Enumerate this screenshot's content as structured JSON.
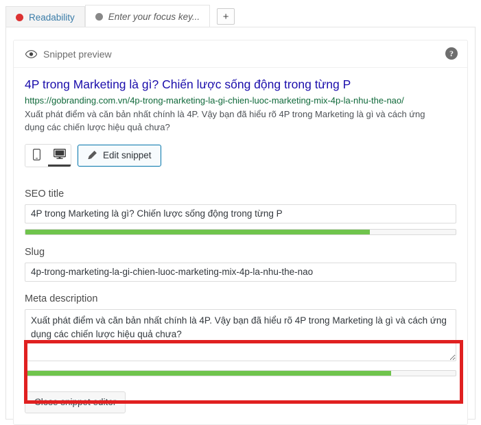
{
  "tabs": [
    {
      "label": "Readability",
      "dot_color": "#dc3232",
      "active": false,
      "name": "tab-readability"
    },
    {
      "label": "Enter your focus key...",
      "dot_color": "#888888",
      "active": true,
      "name": "tab-focus-keyword"
    }
  ],
  "add_tab_label": "+",
  "card": {
    "header_title": "Snippet preview",
    "eye_icon": "eye-icon",
    "help_icon": "help-icon",
    "help_glyph": "?"
  },
  "snippet": {
    "title": "4P trong Marketing là gì? Chiến lược sống động trong từng P",
    "url": "https://gobranding.com.vn/4p-trong-marketing-la-gi-chien-luoc-marketing-mix-4p-la-nhu-the-nao/",
    "description": "Xuất phát điểm và căn bản nhất chính là 4P. Vậy bạn đã hiểu rõ 4P trong Marketing là gì và cách ứng dụng các chiến lược hiệu quả chưa?",
    "title_color": "#1a0dab",
    "url_color": "#10693a"
  },
  "toolbar": {
    "mobile_icon": "mobile-phone-icon",
    "desktop_icon": "desktop-monitor-icon",
    "selected_device": "desktop",
    "edit_snippet_label": "Edit snippet",
    "pencil_icon": "pencil-icon"
  },
  "fields": {
    "seo_title": {
      "label": "SEO title",
      "value": "4P trong Marketing là gì? Chiến lược sống động trong từng P",
      "progress_percent": 80,
      "progress_color": "#6fc44c"
    },
    "slug": {
      "label": "Slug",
      "value": "4p-trong-marketing-la-gi-chien-luoc-marketing-mix-4p-la-nhu-the-nao"
    },
    "meta_description": {
      "label": "Meta description",
      "value": "Xuất phát điểm và căn bản nhất chính là 4P. Vậy bạn đã hiểu rõ 4P trong Marketing là gì và cách ứng dụng các chiến lược hiệu quả chưa?",
      "progress_percent": 85,
      "progress_color": "#6fc44c"
    }
  },
  "close_button_label": "Close snippet editor",
  "highlight": {
    "color": "#e02020",
    "target": "seo-title-field"
  }
}
